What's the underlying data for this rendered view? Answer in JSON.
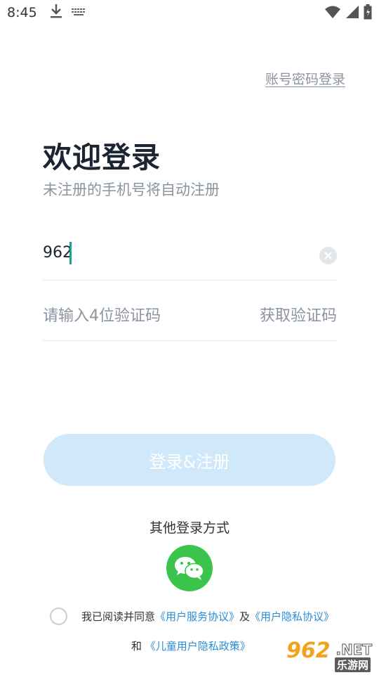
{
  "status_bar": {
    "time": "8:45",
    "icons_left": [
      "download-icon",
      "keyboard-icon"
    ],
    "icons_right": [
      "wifi-icon",
      "signal-icon",
      "battery-icon"
    ]
  },
  "header": {
    "account_login_link": "账号密码登录"
  },
  "welcome": {
    "title": "欢迎登录",
    "subtitle": "未注册的手机号将自动注册"
  },
  "phone_input": {
    "value": "962"
  },
  "code_input": {
    "placeholder": "请输入4位验证码",
    "get_code_label": "获取验证码"
  },
  "login_button": {
    "label": "登录&注册",
    "color": "#cfe9fa"
  },
  "other_login": {
    "label": "其他登录方式",
    "wechat_color": "#3bc44b"
  },
  "agreement": {
    "prefix": "我已阅读并同意",
    "link_service": "《用户服务协议》",
    "and": "及",
    "link_privacy": "《用户隐私协议》",
    "and2": "和",
    "link_child": "《儿童用户隐私政策》"
  },
  "watermark": {
    "brand": "962",
    "suffix": ".NET",
    "sub": "乐游网"
  }
}
